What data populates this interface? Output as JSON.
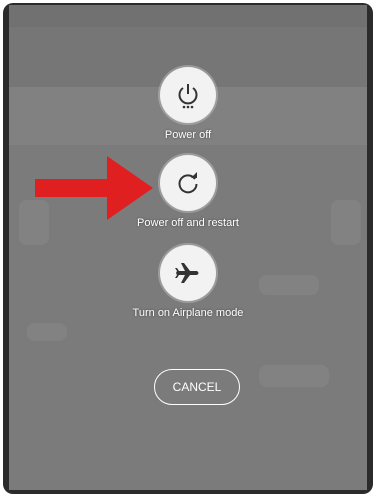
{
  "power_menu": {
    "options": [
      {
        "label": "Power off",
        "icon": "power-icon"
      },
      {
        "label": "Power off and restart",
        "icon": "restart-icon"
      },
      {
        "label": "Turn on Airplane mode",
        "icon": "airplane-icon"
      }
    ],
    "cancel_label": "CANCEL"
  },
  "annotation": {
    "arrow_color": "#e02020",
    "arrow_target": "Power off and restart"
  }
}
